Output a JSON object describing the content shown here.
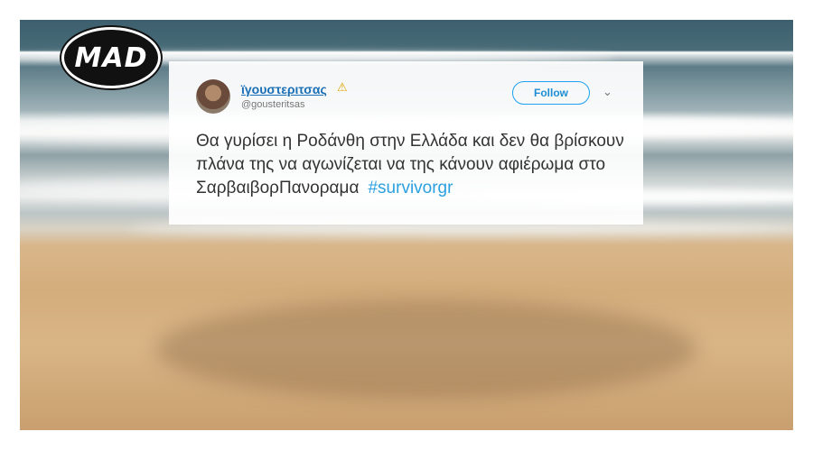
{
  "logo": {
    "text": "MAD"
  },
  "tweet": {
    "display_name": "ϊγουστεριτσας",
    "warning_glyph": "⚠",
    "handle": "@gousteritsas",
    "follow_label": "Follow",
    "chevron": "⌄",
    "body": "Θα γυρίσει η Ροδάνθη στην Ελλάδα και δεν θα βρίσκουν πλάνα της να αγωνίζεται να της κάνουν αφιέρωμα στο ΣαρβαιβορΠανοραμα",
    "hashtag": "#survivorgr"
  },
  "colors": {
    "link": "#1a6fb5",
    "hashtag": "#2aa0df",
    "follow_border": "#1da1f2"
  }
}
